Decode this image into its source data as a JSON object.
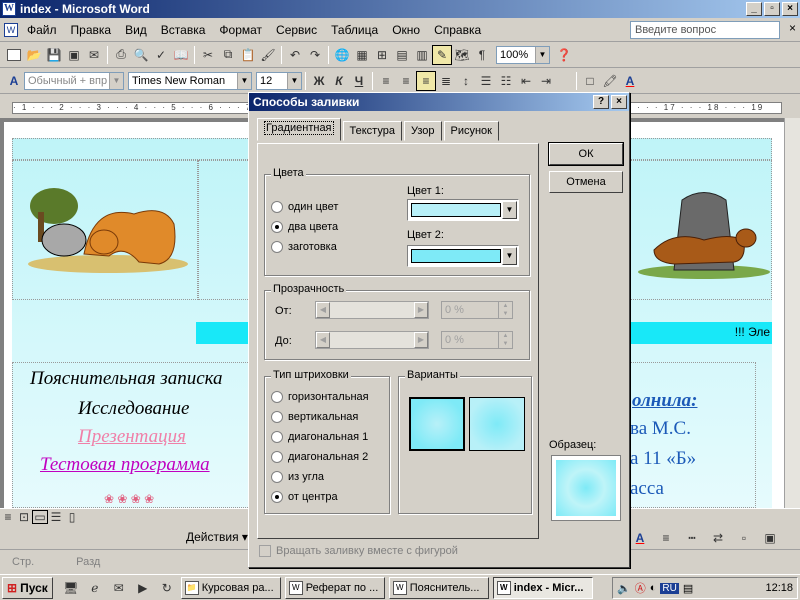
{
  "window": {
    "title": "index - Microsoft Word"
  },
  "menu": [
    "Файл",
    "Правка",
    "Вид",
    "Вставка",
    "Формат",
    "Сервис",
    "Таблица",
    "Окно",
    "Справка"
  ],
  "ask_placeholder": "Введите вопрос",
  "toolbar": {
    "zoom": "100%",
    "style": "Обычный + впр",
    "font": "Times New Roman",
    "size": "12",
    "bold": "Ж",
    "italic": "К",
    "underline": "Ч"
  },
  "ruler_text": "· 1 · · · 2 · · · 3 · · · 4 · · · 5 · · · 6 · · · 7 · · · 8 · · · 9 · · · 10 · · · 11 · · · 12 · · · 13 · · · 14 · · · 15 · · · 16 · · · 17 · · · 18 · · · 19",
  "document": {
    "banner_text": "!!! Эле",
    "links": [
      "Пояснительная записка",
      "Исследование",
      "Презентация",
      "Тестовая программа"
    ],
    "right_title": "олнила:",
    "right_lines": [
      "ва М.С.",
      "а 11 «Б»",
      "асса"
    ],
    "link_colors": {
      "l1": "#000000",
      "l2": "#000000",
      "l3": "#f080a8",
      "l4": "#c000c0",
      "right": "#1c5ab8"
    }
  },
  "dialog": {
    "title": "Способы заливки",
    "help": "?",
    "close": "×",
    "tabs": [
      "Градиентная",
      "Текстура",
      "Узор",
      "Рисунок"
    ],
    "colors_group": "Цвета",
    "color_options": [
      "один цвет",
      "два цвета",
      "заготовка"
    ],
    "color_selected": "два цвета",
    "color1_label": "Цвет 1:",
    "color2_label": "Цвет 2:",
    "color1": "#b8f0f8",
    "color2": "#7eeaf7",
    "transparency_group": "Прозрачность",
    "from_label": "От:",
    "to_label": "До:",
    "from_value": "0 %",
    "to_value": "0 %",
    "shading_group": "Тип штриховки",
    "shading_options": [
      "горизонтальная",
      "вертикальная",
      "диагональная 1",
      "диагональная 2",
      "из угла",
      "от центра"
    ],
    "shading_selected": "от центра",
    "variants_group": "Варианты",
    "sample_label": "Образец:",
    "ok": "ОК",
    "cancel": "Отмена",
    "rotate_label": "Вращать заливку вместе с фигурой"
  },
  "drawbar": {
    "actions": "Действия"
  },
  "status": [
    "Стр.",
    "Разд"
  ],
  "taskbar": {
    "start": "Пуск",
    "tasks": [
      "Курсовая ра...",
      "Реферат по ...",
      "Пояснитель...",
      "index - Micr..."
    ],
    "lang": "RU",
    "clock": "12:18"
  }
}
